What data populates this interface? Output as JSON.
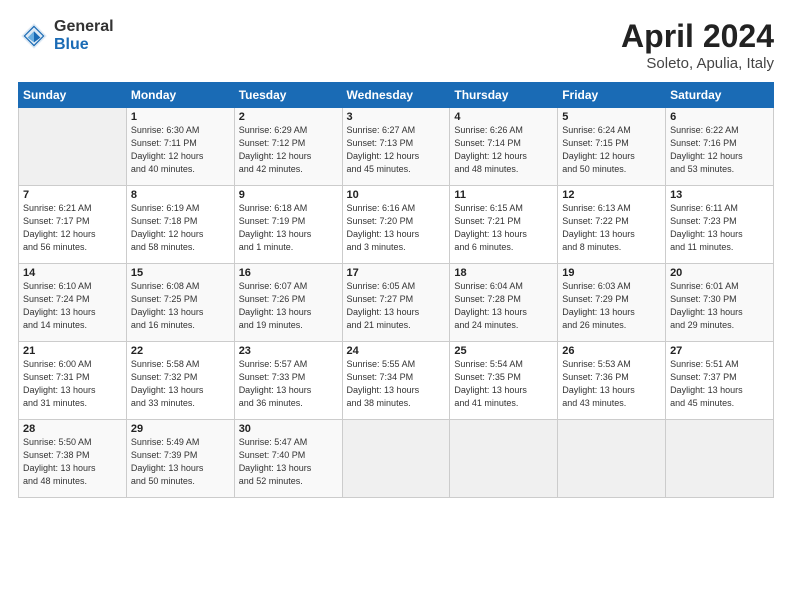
{
  "header": {
    "logo_general": "General",
    "logo_blue": "Blue",
    "month": "April 2024",
    "location": "Soleto, Apulia, Italy"
  },
  "days_of_week": [
    "Sunday",
    "Monday",
    "Tuesday",
    "Wednesday",
    "Thursday",
    "Friday",
    "Saturday"
  ],
  "weeks": [
    [
      {
        "day": "",
        "info": ""
      },
      {
        "day": "1",
        "info": "Sunrise: 6:30 AM\nSunset: 7:11 PM\nDaylight: 12 hours\nand 40 minutes."
      },
      {
        "day": "2",
        "info": "Sunrise: 6:29 AM\nSunset: 7:12 PM\nDaylight: 12 hours\nand 42 minutes."
      },
      {
        "day": "3",
        "info": "Sunrise: 6:27 AM\nSunset: 7:13 PM\nDaylight: 12 hours\nand 45 minutes."
      },
      {
        "day": "4",
        "info": "Sunrise: 6:26 AM\nSunset: 7:14 PM\nDaylight: 12 hours\nand 48 minutes."
      },
      {
        "day": "5",
        "info": "Sunrise: 6:24 AM\nSunset: 7:15 PM\nDaylight: 12 hours\nand 50 minutes."
      },
      {
        "day": "6",
        "info": "Sunrise: 6:22 AM\nSunset: 7:16 PM\nDaylight: 12 hours\nand 53 minutes."
      }
    ],
    [
      {
        "day": "7",
        "info": "Sunrise: 6:21 AM\nSunset: 7:17 PM\nDaylight: 12 hours\nand 56 minutes."
      },
      {
        "day": "8",
        "info": "Sunrise: 6:19 AM\nSunset: 7:18 PM\nDaylight: 12 hours\nand 58 minutes."
      },
      {
        "day": "9",
        "info": "Sunrise: 6:18 AM\nSunset: 7:19 PM\nDaylight: 13 hours\nand 1 minute."
      },
      {
        "day": "10",
        "info": "Sunrise: 6:16 AM\nSunset: 7:20 PM\nDaylight: 13 hours\nand 3 minutes."
      },
      {
        "day": "11",
        "info": "Sunrise: 6:15 AM\nSunset: 7:21 PM\nDaylight: 13 hours\nand 6 minutes."
      },
      {
        "day": "12",
        "info": "Sunrise: 6:13 AM\nSunset: 7:22 PM\nDaylight: 13 hours\nand 8 minutes."
      },
      {
        "day": "13",
        "info": "Sunrise: 6:11 AM\nSunset: 7:23 PM\nDaylight: 13 hours\nand 11 minutes."
      }
    ],
    [
      {
        "day": "14",
        "info": "Sunrise: 6:10 AM\nSunset: 7:24 PM\nDaylight: 13 hours\nand 14 minutes."
      },
      {
        "day": "15",
        "info": "Sunrise: 6:08 AM\nSunset: 7:25 PM\nDaylight: 13 hours\nand 16 minutes."
      },
      {
        "day": "16",
        "info": "Sunrise: 6:07 AM\nSunset: 7:26 PM\nDaylight: 13 hours\nand 19 minutes."
      },
      {
        "day": "17",
        "info": "Sunrise: 6:05 AM\nSunset: 7:27 PM\nDaylight: 13 hours\nand 21 minutes."
      },
      {
        "day": "18",
        "info": "Sunrise: 6:04 AM\nSunset: 7:28 PM\nDaylight: 13 hours\nand 24 minutes."
      },
      {
        "day": "19",
        "info": "Sunrise: 6:03 AM\nSunset: 7:29 PM\nDaylight: 13 hours\nand 26 minutes."
      },
      {
        "day": "20",
        "info": "Sunrise: 6:01 AM\nSunset: 7:30 PM\nDaylight: 13 hours\nand 29 minutes."
      }
    ],
    [
      {
        "day": "21",
        "info": "Sunrise: 6:00 AM\nSunset: 7:31 PM\nDaylight: 13 hours\nand 31 minutes."
      },
      {
        "day": "22",
        "info": "Sunrise: 5:58 AM\nSunset: 7:32 PM\nDaylight: 13 hours\nand 33 minutes."
      },
      {
        "day": "23",
        "info": "Sunrise: 5:57 AM\nSunset: 7:33 PM\nDaylight: 13 hours\nand 36 minutes."
      },
      {
        "day": "24",
        "info": "Sunrise: 5:55 AM\nSunset: 7:34 PM\nDaylight: 13 hours\nand 38 minutes."
      },
      {
        "day": "25",
        "info": "Sunrise: 5:54 AM\nSunset: 7:35 PM\nDaylight: 13 hours\nand 41 minutes."
      },
      {
        "day": "26",
        "info": "Sunrise: 5:53 AM\nSunset: 7:36 PM\nDaylight: 13 hours\nand 43 minutes."
      },
      {
        "day": "27",
        "info": "Sunrise: 5:51 AM\nSunset: 7:37 PM\nDaylight: 13 hours\nand 45 minutes."
      }
    ],
    [
      {
        "day": "28",
        "info": "Sunrise: 5:50 AM\nSunset: 7:38 PM\nDaylight: 13 hours\nand 48 minutes."
      },
      {
        "day": "29",
        "info": "Sunrise: 5:49 AM\nSunset: 7:39 PM\nDaylight: 13 hours\nand 50 minutes."
      },
      {
        "day": "30",
        "info": "Sunrise: 5:47 AM\nSunset: 7:40 PM\nDaylight: 13 hours\nand 52 minutes."
      },
      {
        "day": "",
        "info": ""
      },
      {
        "day": "",
        "info": ""
      },
      {
        "day": "",
        "info": ""
      },
      {
        "day": "",
        "info": ""
      }
    ]
  ]
}
